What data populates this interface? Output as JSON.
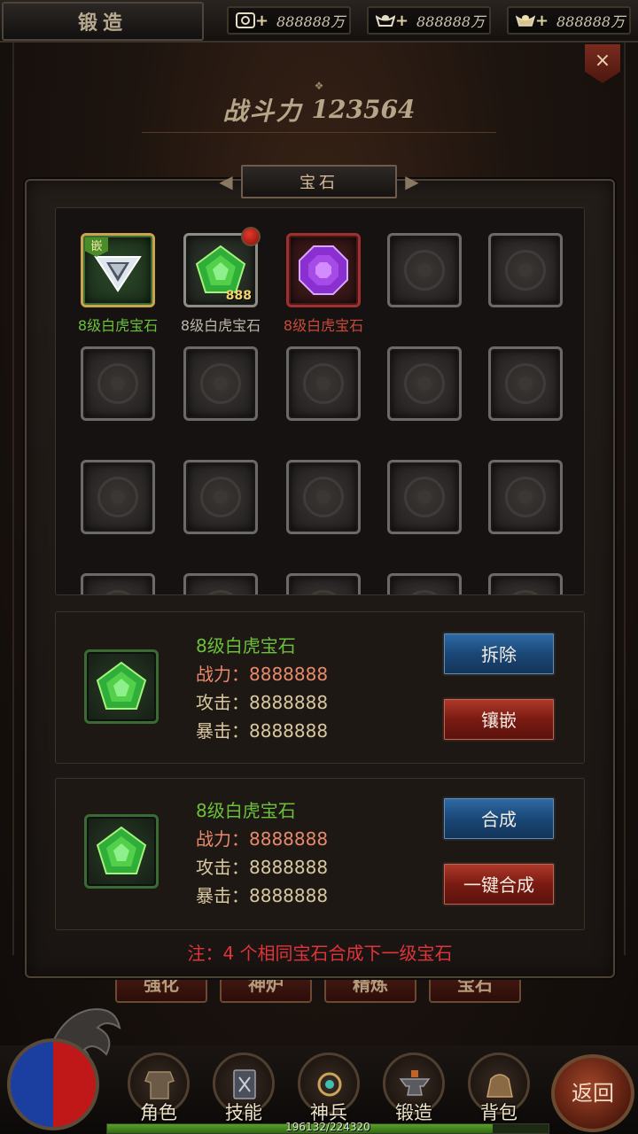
{
  "header": {
    "title": "锻造",
    "currencies": [
      {
        "icon": "coin-icon",
        "amount": "888888万"
      },
      {
        "icon": "ingot-icon",
        "amount": "888888万"
      },
      {
        "icon": "gold-ingot-icon",
        "amount": "888888万"
      }
    ],
    "close_label": "×"
  },
  "power": {
    "label": "战斗力",
    "value": "123564"
  },
  "background_tabs": [
    "强化",
    "神炉",
    "精炼",
    "宝石"
  ],
  "dialog": {
    "title": "宝石",
    "gem_slots": [
      {
        "name": "8级白虎宝石",
        "color": "#6bc13a",
        "gem": "white-diamond-gem-icon",
        "inlaid": true,
        "inlay_tag": "嵌"
      },
      {
        "name": "8级白虎宝石",
        "color": "#bdb5a6",
        "gem": "green-gem-icon",
        "count": "888",
        "has_alert": true
      },
      {
        "name": "8级白虎宝石",
        "color": "#c94a3a",
        "gem": "purple-gem-icon"
      }
    ],
    "detail_top": {
      "name": "8级白虎宝石",
      "power": "战力：8888888",
      "attack": "攻击：8888888",
      "crit": "暴击：8888888",
      "btn_remove": "拆除",
      "btn_inlay": "镶嵌"
    },
    "detail_bottom": {
      "name": "8级白虎宝石",
      "power": "战力：8888888",
      "attack": "攻击：8888888",
      "crit": "暴击：8888888",
      "btn_combine": "合成",
      "btn_combine_all": "一键合成"
    },
    "note": "注：4 个相同宝石合成下一级宝石"
  },
  "bottom_nav": {
    "items": [
      "角色",
      "技能",
      "神兵",
      "锻造",
      "背包"
    ],
    "back_label": "返回",
    "exp_text": "196132/224320",
    "exp_fraction": 0.874
  }
}
